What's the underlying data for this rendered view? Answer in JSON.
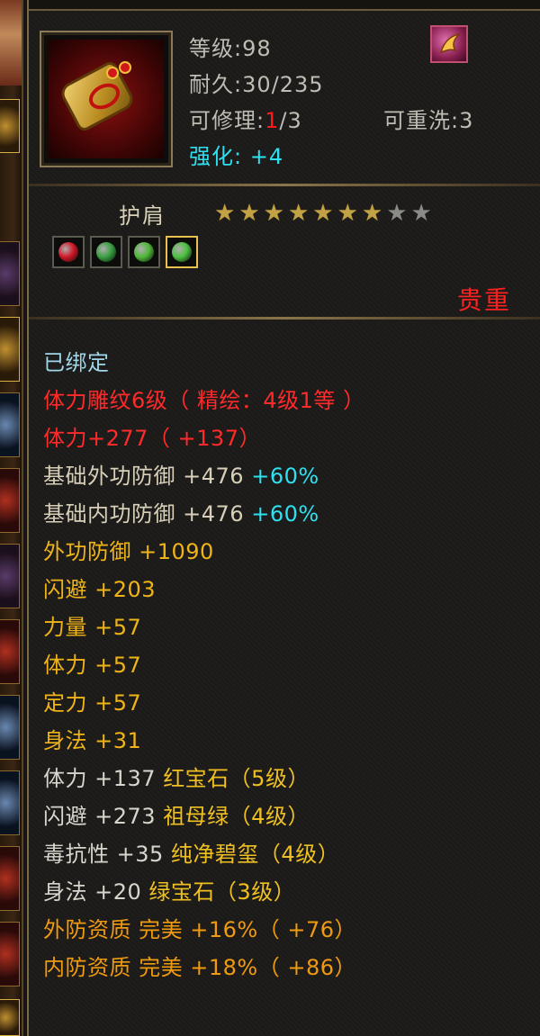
{
  "item": {
    "level_label": "等级:",
    "level": "98",
    "durability_label": "耐久:",
    "durability": "30/235",
    "repair_label": "可修理:",
    "repair_used": "1",
    "repair_total": "/3",
    "rewash_label": "可重洗:",
    "rewash": "3",
    "enhance_label": "强化:",
    "enhance": "+4",
    "name": "护肩",
    "stars_filled": 7,
    "stars_total": 9,
    "rarity": "贵重",
    "gems": [
      {
        "name": "ruby-gem",
        "color": "#d01828"
      },
      {
        "name": "emerald-gem",
        "color": "#38a040"
      },
      {
        "name": "jade-gem",
        "color": "#50b838"
      },
      {
        "name": "green-gem",
        "color": "#4cc040"
      }
    ]
  },
  "attributes": {
    "bound": "已绑定",
    "carving": "体力雕纹6级（ 精绘：4级1等 ）",
    "stamina_main": "体力+277（ +137）",
    "base_ext_def_label": "基础外功防御",
    "base_ext_def_value": "+476",
    "base_ext_def_pct": "+60%",
    "base_int_def_label": "基础内功防御",
    "base_int_def_value": "+476",
    "base_int_def_pct": "+60%",
    "ext_def": "外功防御  +1090",
    "dodge": "闪避  +203",
    "strength": "力量  +57",
    "stamina": "体力  +57",
    "focus": "定力  +57",
    "agility": "身法  +31",
    "gem_lines": [
      {
        "stat": "体力  +137",
        "gem": "红宝石（5级）"
      },
      {
        "stat": "闪避  +273",
        "gem": "祖母绿（4级）"
      },
      {
        "stat": "毒抗性  +35",
        "gem": "纯净碧玺（4级）"
      },
      {
        "stat": "身法  +20",
        "gem": "绿宝石（3级）"
      }
    ],
    "ext_quality": "外防资质    完美  +16%（ +76）",
    "int_quality": "内防资质    完美  +18%（ +86）"
  }
}
